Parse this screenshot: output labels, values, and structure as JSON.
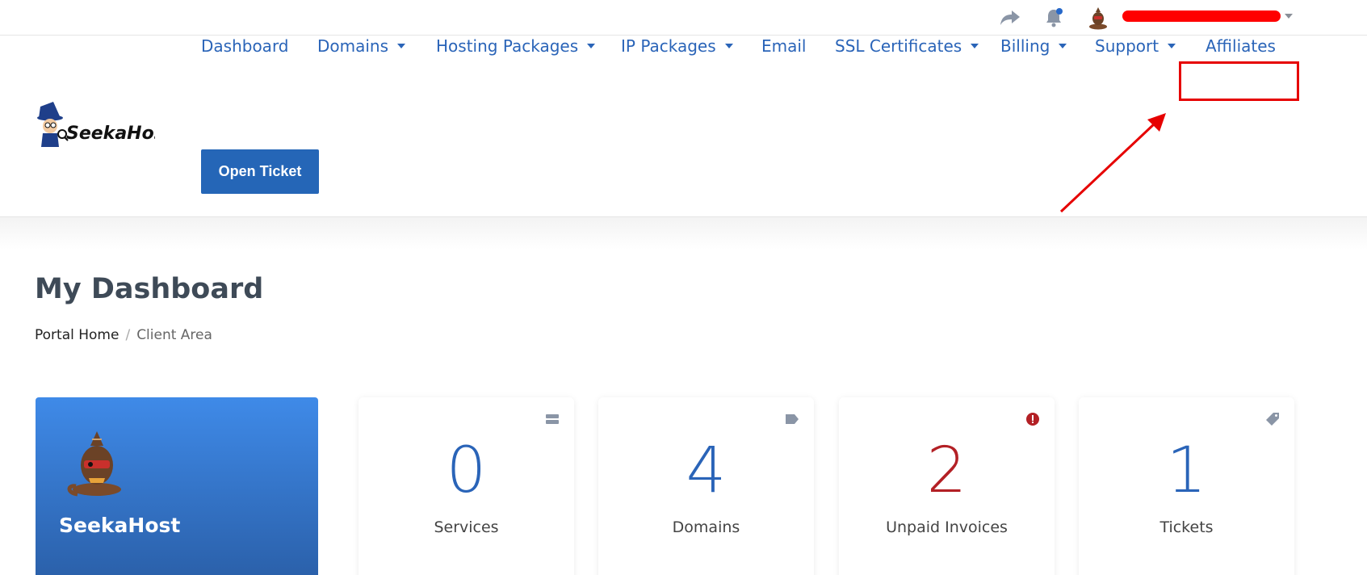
{
  "topbar": {
    "icons": [
      "share-icon",
      "bell-icon",
      "avatar",
      "chevron-down-icon"
    ]
  },
  "brand": {
    "logo_text": "SeekaHost"
  },
  "nav": {
    "items": [
      {
        "label": "Dashboard",
        "dropdown": false
      },
      {
        "label": "Domains",
        "dropdown": true
      },
      {
        "label": "Hosting Packages",
        "dropdown": true
      },
      {
        "label": "IP Packages",
        "dropdown": true
      },
      {
        "label": "Email",
        "dropdown": false
      },
      {
        "label": "SSL Certificates",
        "dropdown": true
      },
      {
        "label": "Billing",
        "dropdown": true
      },
      {
        "label": "Support",
        "dropdown": true
      },
      {
        "label": "Affiliates",
        "dropdown": false
      }
    ],
    "open_ticket_label": "Open Ticket"
  },
  "page": {
    "title": "My Dashboard",
    "breadcrumb": {
      "home": "Portal Home",
      "separator": "/",
      "current": "Client Area"
    }
  },
  "profile": {
    "name": "SeekaHost"
  },
  "stats": [
    {
      "value": "0",
      "label": "Services",
      "icon": "server-icon"
    },
    {
      "value": "4",
      "label": "Domains",
      "icon": "tag-icon"
    },
    {
      "value": "2",
      "label": "Unpaid Invoices",
      "icon": "alert-icon"
    },
    {
      "value": "1",
      "label": "Tickets",
      "icon": "ticket-icon"
    }
  ],
  "colors": {
    "accent": "#2a64b8",
    "button": "#2566b7",
    "alert": "#b32025",
    "highlight": "#e60000"
  }
}
